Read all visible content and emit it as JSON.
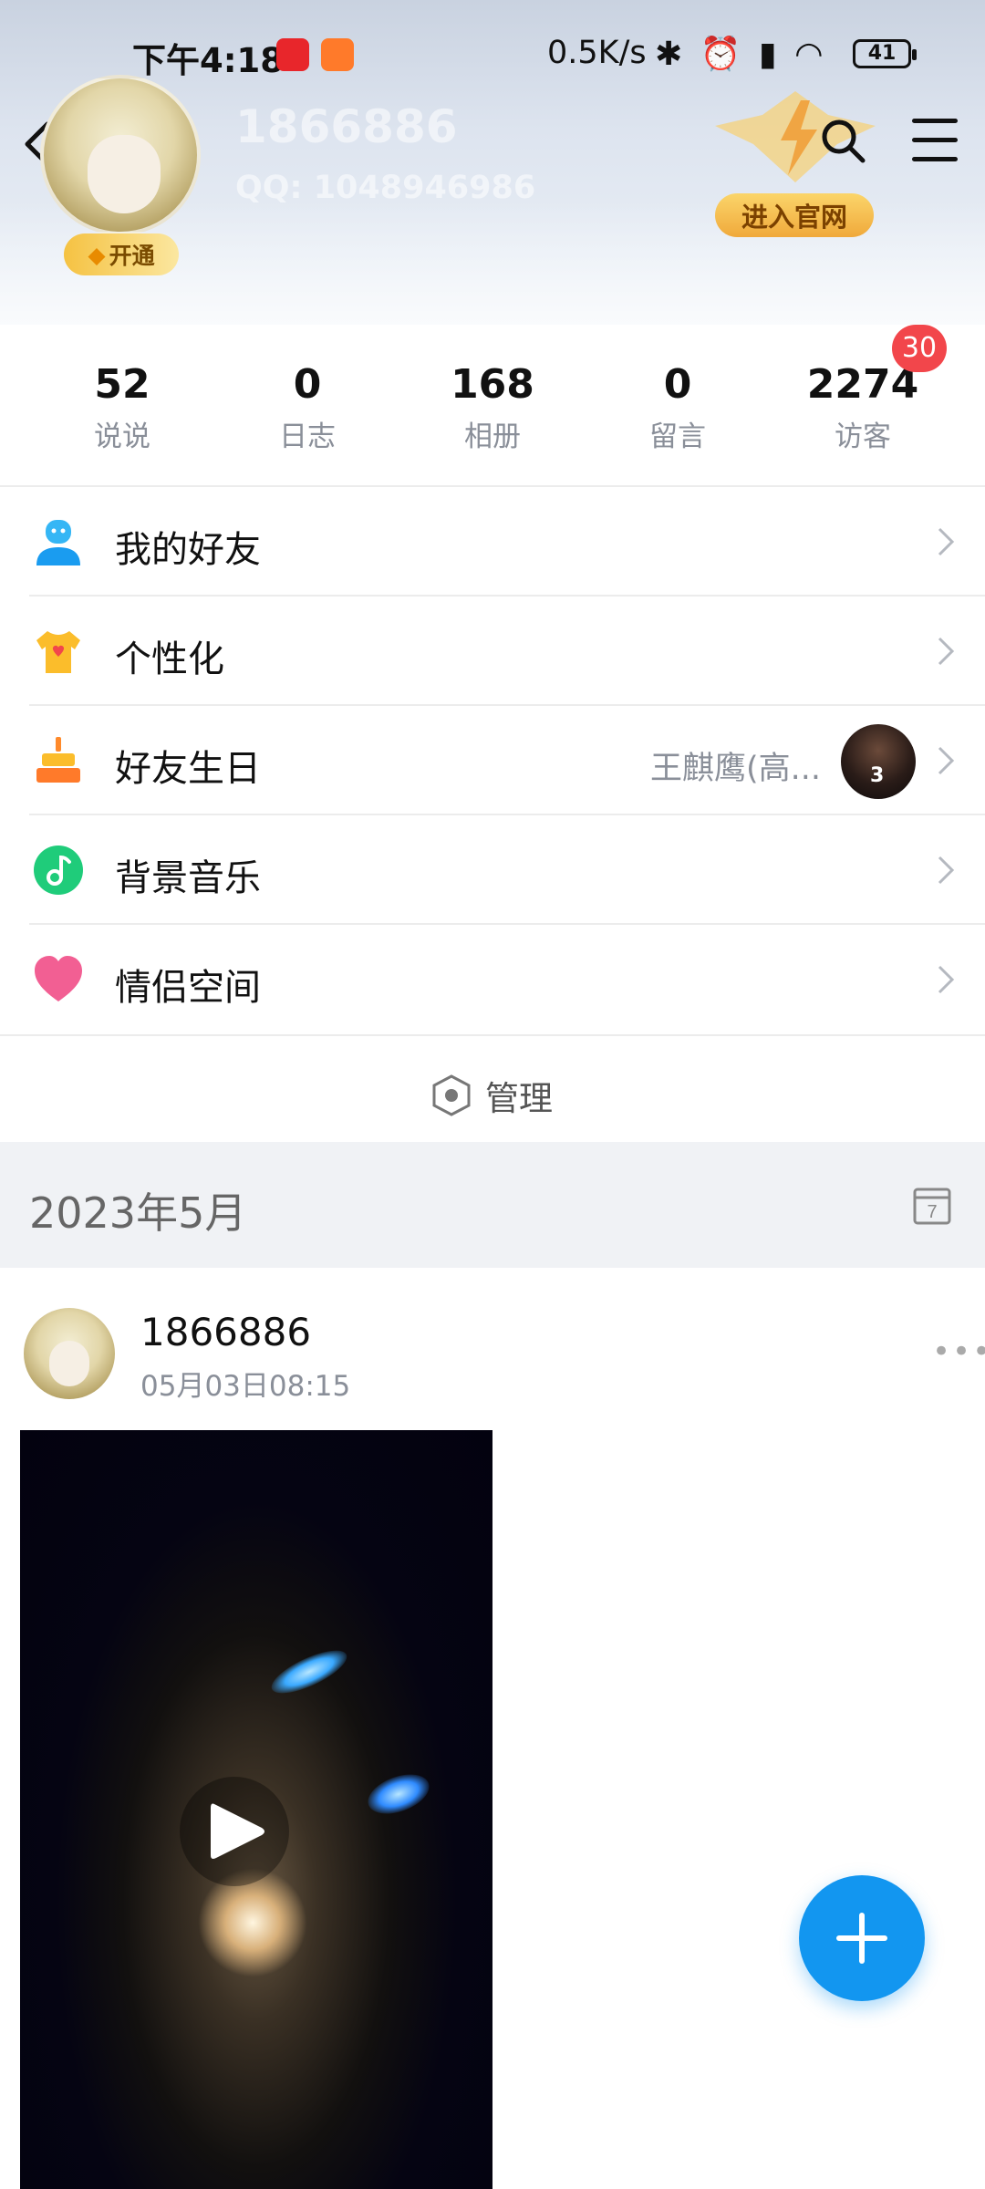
{
  "status_bar": {
    "time": "下午4:18",
    "network_speed": "0.5K/s",
    "icons": [
      "bluetooth-icon",
      "alarm-icon",
      "hd-signal-icon",
      "wifi-icon"
    ],
    "battery": "41"
  },
  "profile": {
    "name": "1866886",
    "qq_number": "QQ: 1048946986",
    "vip_label": "开通",
    "official_site_label": "进入官网"
  },
  "stats": [
    {
      "value": "52",
      "label": "说说"
    },
    {
      "value": "0",
      "label": "日志"
    },
    {
      "value": "168",
      "label": "相册"
    },
    {
      "value": "0",
      "label": "留言"
    },
    {
      "value": "2274",
      "label": "访客",
      "badge": "30"
    }
  ],
  "menu": {
    "items": [
      {
        "label": "我的好友",
        "icon": "friends-icon"
      },
      {
        "label": "个性化",
        "icon": "tshirt-icon"
      },
      {
        "label": "好友生日",
        "icon": "cake-icon",
        "extra": "王麒鹰(高..."
      },
      {
        "label": "背景音乐",
        "icon": "music-icon"
      },
      {
        "label": "情侣空间",
        "icon": "heart-icon"
      }
    ],
    "manage_label": "管理"
  },
  "feed": {
    "date_header": "2023年5月",
    "calendar_day": "7",
    "post": {
      "author": "1866886",
      "time": "05月03日08:15"
    }
  },
  "colors": {
    "accent": "#1296f0",
    "badge": "#f2464b",
    "vip_gold": "#f5c242"
  }
}
